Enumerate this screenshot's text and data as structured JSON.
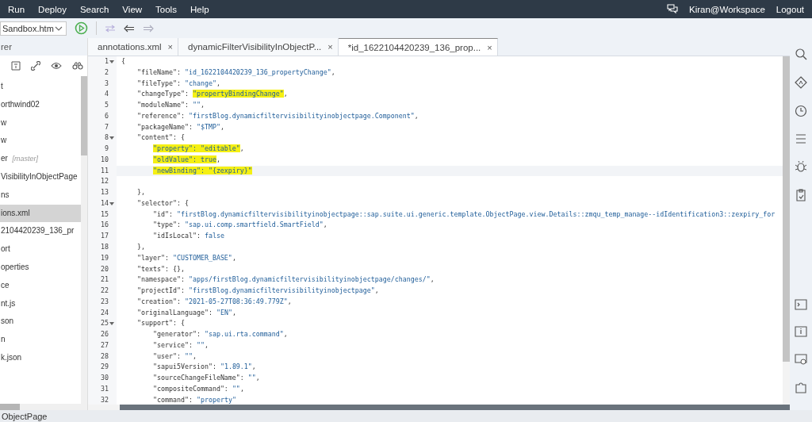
{
  "menu": [
    "Run",
    "Deploy",
    "Search",
    "View",
    "Tools",
    "Help"
  ],
  "user": {
    "name": "Kiran@Workspace",
    "logout": "Logout"
  },
  "toolbar": {
    "file_select": "Sandbox.htm"
  },
  "explorer": {
    "title": "rer",
    "items": [
      {
        "label": "t",
        "selected": false
      },
      {
        "label": "orthwind02",
        "selected": false
      },
      {
        "label": "w",
        "selected": false
      },
      {
        "label": "w",
        "selected": false
      },
      {
        "label": "er",
        "tag": "[master]",
        "selected": false
      },
      {
        "label": "VisibilityInObjectPage",
        "selected": false
      },
      {
        "label": "ns",
        "selected": false
      },
      {
        "label": "ions.xml",
        "selected": true
      },
      {
        "label": "2104420239_136_pr",
        "selected": false
      },
      {
        "label": "ort",
        "selected": false
      },
      {
        "label": "operties",
        "selected": false
      },
      {
        "label": "ce",
        "selected": false
      },
      {
        "label": "nt.js",
        "selected": false
      },
      {
        "label": "son",
        "selected": false
      },
      {
        "label": "n",
        "selected": false
      },
      {
        "label": "k.json",
        "selected": false
      }
    ]
  },
  "tabs": [
    {
      "label": "annotations.xml",
      "close": "×",
      "selected": false
    },
    {
      "label": "dynamicFilterVisibilityInObjectP...",
      "close": "×",
      "selected": false
    },
    {
      "label": "*id_1622104420239_136_prop...",
      "close": "×",
      "selected": true
    }
  ],
  "editor": {
    "lines": [
      {
        "number": "1",
        "foldable": true,
        "current": false,
        "segments": [
          {
            "text": "{",
            "kind": "key"
          }
        ]
      },
      {
        "number": "2",
        "foldable": false,
        "current": false,
        "segments": [
          {
            "text": "    \"fileName\": ",
            "kind": "key"
          },
          {
            "text": "\"id_1622104420239_136_propertyChange\"",
            "kind": "str"
          },
          {
            "text": ",",
            "kind": "key"
          }
        ]
      },
      {
        "number": "3",
        "foldable": false,
        "current": false,
        "segments": [
          {
            "text": "    \"fileType\": ",
            "kind": "key"
          },
          {
            "text": "\"change\"",
            "kind": "str"
          },
          {
            "text": ",",
            "kind": "key"
          }
        ]
      },
      {
        "number": "4",
        "foldable": false,
        "current": false,
        "segments": [
          {
            "text": "    \"changeType\": ",
            "kind": "key"
          },
          {
            "text": "\"propertyBindingChange\"",
            "kind": "mark"
          },
          {
            "text": ",",
            "kind": "key"
          }
        ]
      },
      {
        "number": "5",
        "foldable": false,
        "current": false,
        "segments": [
          {
            "text": "    \"moduleName\": ",
            "kind": "key"
          },
          {
            "text": "\"\"",
            "kind": "str"
          },
          {
            "text": ",",
            "kind": "key"
          }
        ]
      },
      {
        "number": "6",
        "foldable": false,
        "current": false,
        "segments": [
          {
            "text": "    \"reference\": ",
            "kind": "key"
          },
          {
            "text": "\"firstBlog.dynamicfiltervisibilityinobjectpage.Component\"",
            "kind": "str"
          },
          {
            "text": ",",
            "kind": "key"
          }
        ]
      },
      {
        "number": "7",
        "foldable": false,
        "current": false,
        "segments": [
          {
            "text": "    \"packageName\": ",
            "kind": "key"
          },
          {
            "text": "\"$TMP\"",
            "kind": "str"
          },
          {
            "text": ",",
            "kind": "key"
          }
        ]
      },
      {
        "number": "8",
        "foldable": true,
        "current": false,
        "segments": [
          {
            "text": "    \"content\": {",
            "kind": "key"
          }
        ]
      },
      {
        "number": "9",
        "foldable": false,
        "current": false,
        "segments": [
          {
            "text": "\"property\": \"editable\"",
            "kind": "mark"
          },
          {
            "text": ",",
            "kind": "key"
          }
        ]
      },
      {
        "number": "10",
        "foldable": false,
        "current": false,
        "segments": [
          {
            "text": "\"oldValue\": true",
            "kind": "mark"
          },
          {
            "text": ",",
            "kind": "key"
          }
        ]
      },
      {
        "number": "11",
        "foldable": false,
        "current": true,
        "segments": [
          {
            "text": "\"newBinding\": \"{zexpiry}\"",
            "kind": "mark"
          }
        ]
      },
      {
        "number": "12",
        "foldable": false,
        "current": false
      },
      {
        "number": "13",
        "foldable": false,
        "current": false,
        "segments": [
          {
            "text": "    },",
            "kind": "key"
          }
        ]
      },
      {
        "number": "14",
        "foldable": true,
        "current": false,
        "segments": [
          {
            "text": "    \"selector\": {",
            "kind": "key"
          }
        ]
      },
      {
        "number": "15",
        "foldable": false,
        "current": false,
        "segments": [
          {
            "text": "        \"id\": ",
            "kind": "key"
          },
          {
            "text": "\"firstBlog.dynamicfiltervisibilityinobjectpage::sap.suite.ui.generic.template.ObjectPage.view.Details::zmqu_temp_manage--idIdentification3::zexpiry_for",
            "kind": "str"
          }
        ]
      },
      {
        "number": "16",
        "foldable": false,
        "current": false,
        "segments": [
          {
            "text": "        \"type\": ",
            "kind": "key"
          },
          {
            "text": "\"sap.ui.comp.smartfield.SmartField\"",
            "kind": "str"
          },
          {
            "text": ",",
            "kind": "key"
          }
        ]
      },
      {
        "number": "17",
        "foldable": false,
        "current": false,
        "segments": [
          {
            "text": "        \"idIsLocal\": ",
            "kind": "key"
          },
          {
            "text": "false",
            "kind": "str"
          }
        ]
      },
      {
        "number": "18",
        "foldable": false,
        "current": false,
        "segments": [
          {
            "text": "    },",
            "kind": "key"
          }
        ]
      },
      {
        "number": "19",
        "foldable": false,
        "current": false,
        "segments": [
          {
            "text": "    \"layer\": ",
            "kind": "key"
          },
          {
            "text": "\"CUSTOMER_BASE\"",
            "kind": "str"
          },
          {
            "text": ",",
            "kind": "key"
          }
        ]
      },
      {
        "number": "20",
        "foldable": false,
        "current": false,
        "segments": [
          {
            "text": "    \"texts\": {},",
            "kind": "key"
          }
        ]
      },
      {
        "number": "21",
        "foldable": false,
        "current": false,
        "segments": [
          {
            "text": "    \"namespace\": ",
            "kind": "key"
          },
          {
            "text": "\"apps/firstBlog.dynamicfiltervisibilityinobjectpage/changes/\"",
            "kind": "str"
          },
          {
            "text": ",",
            "kind": "key"
          }
        ]
      },
      {
        "number": "22",
        "foldable": false,
        "current": false,
        "segments": [
          {
            "text": "    \"projectId\": ",
            "kind": "key"
          },
          {
            "text": "\"firstBlog.dynamicfiltervisibilityinobjectpage\"",
            "kind": "str"
          },
          {
            "text": ",",
            "kind": "key"
          }
        ]
      },
      {
        "number": "23",
        "foldable": false,
        "current": false,
        "segments": [
          {
            "text": "    \"creation\": ",
            "kind": "key"
          },
          {
            "text": "\"2021-05-27T08:36:49.779Z\"",
            "kind": "str"
          },
          {
            "text": ",",
            "kind": "key"
          }
        ]
      },
      {
        "number": "24",
        "foldable": false,
        "current": false,
        "segments": [
          {
            "text": "    \"originalLanguage\": ",
            "kind": "key"
          },
          {
            "text": "\"EN\"",
            "kind": "str"
          },
          {
            "text": ",",
            "kind": "key"
          }
        ]
      },
      {
        "number": "25",
        "foldable": true,
        "current": false,
        "segments": [
          {
            "text": "    \"support\": {",
            "kind": "key"
          }
        ]
      },
      {
        "number": "26",
        "foldable": false,
        "current": false,
        "segments": [
          {
            "text": "        \"generator\": ",
            "kind": "key"
          },
          {
            "text": "\"sap.ui.rta.command\"",
            "kind": "str"
          },
          {
            "text": ",",
            "kind": "key"
          }
        ]
      },
      {
        "number": "27",
        "foldable": false,
        "current": false,
        "segments": [
          {
            "text": "        \"service\": ",
            "kind": "key"
          },
          {
            "text": "\"\"",
            "kind": "str"
          },
          {
            "text": ",",
            "kind": "key"
          }
        ]
      },
      {
        "number": "28",
        "foldable": false,
        "current": false,
        "segments": [
          {
            "text": "        \"user\": ",
            "kind": "key"
          },
          {
            "text": "\"\"",
            "kind": "str"
          },
          {
            "text": ",",
            "kind": "key"
          }
        ]
      },
      {
        "number": "29",
        "foldable": false,
        "current": false,
        "segments": [
          {
            "text": "        \"sapui5Version\": ",
            "kind": "key"
          },
          {
            "text": "\"1.89.1\"",
            "kind": "str"
          },
          {
            "text": ",",
            "kind": "key"
          }
        ]
      },
      {
        "number": "30",
        "foldable": false,
        "current": false,
        "segments": [
          {
            "text": "        \"sourceChangeFileName\": ",
            "kind": "key"
          },
          {
            "text": "\"\"",
            "kind": "str"
          },
          {
            "text": ",",
            "kind": "key"
          }
        ]
      },
      {
        "number": "31",
        "foldable": false,
        "current": false,
        "segments": [
          {
            "text": "        \"compositeCommand\": ",
            "kind": "key"
          },
          {
            "text": "\"\"",
            "kind": "str"
          },
          {
            "text": ",",
            "kind": "key"
          }
        ]
      },
      {
        "number": "32",
        "foldable": false,
        "current": false,
        "segments": [
          {
            "text": "        \"command\": ",
            "kind": "key"
          },
          {
            "text": "\"property\"",
            "kind": "str"
          }
        ]
      }
    ]
  },
  "status_bar": {
    "text": "ObjectPage"
  }
}
